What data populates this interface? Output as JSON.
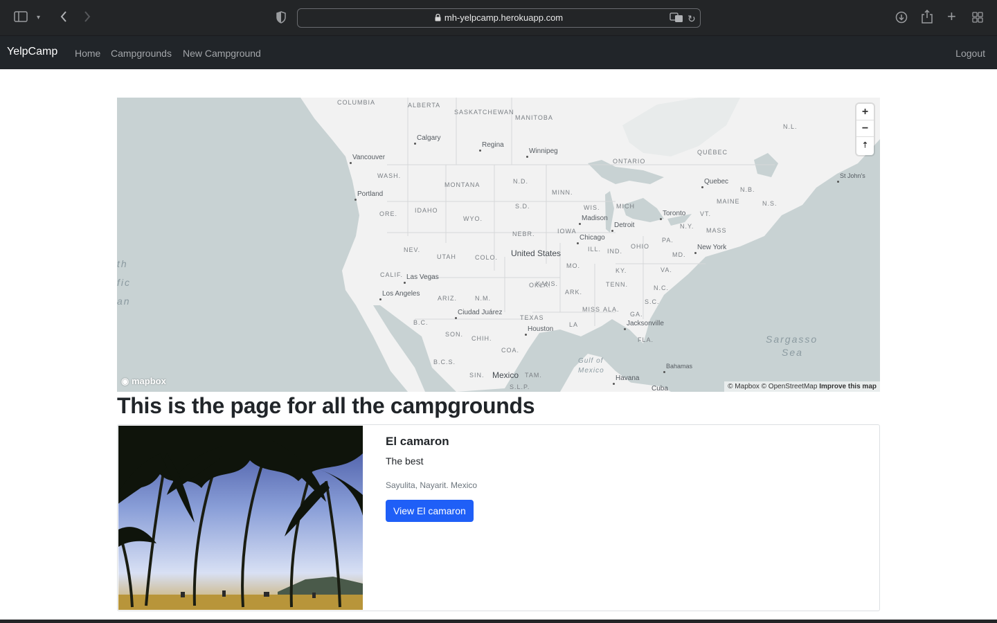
{
  "browser": {
    "url": "mh-yelpcamp.herokuapp.com"
  },
  "navbar": {
    "brand": "YelpCamp",
    "links": [
      "Home",
      "Campgrounds",
      "New Campground"
    ],
    "logout": "Logout"
  },
  "map": {
    "regions": [
      "COLUMBIA",
      "ALBERTA",
      "SASKATCHEWAN",
      "MANITOBA",
      "ONTARIO",
      "QUÉBEC",
      "N.L.",
      "WASH.",
      "MONTANA",
      "N.D.",
      "MINN.",
      "N.B.",
      "MAINE",
      "N.S.",
      "ORE.",
      "IDAHO",
      "S.D.",
      "WIS.",
      "MICH",
      "WYO.",
      "N.Y.",
      "MASS",
      "VT.",
      "NEBR.",
      "IOWA",
      "NEV.",
      "UTAH",
      "COLO.",
      "ILL.",
      "IND.",
      "OHIO",
      "PA.",
      "MO.",
      "KY.",
      "VA.",
      "MD.",
      "CALIF.",
      "KANS.",
      "OKLA.",
      "ARK.",
      "TENN.",
      "N.C.",
      "ARIZ.",
      "N.M.",
      "MISS",
      "ALA.",
      "GA.",
      "S.C.",
      "TEXAS",
      "LA",
      "FLA.",
      "SON.",
      "CHIH.",
      "COA.",
      "B.C.",
      "B.C.S.",
      "S.L.P.",
      "TAM.",
      "SIN."
    ],
    "cities": [
      "Calgary",
      "Regina",
      "Winnipeg",
      "Vancouver",
      "Portland",
      "Quebec",
      "St John's",
      "Toronto",
      "Madison",
      "Detroit",
      "Chicago",
      "New York",
      "Las Vegas",
      "Los Angeles",
      "Ciudad Juárez",
      "Houston",
      "Jacksonville",
      "Havana",
      "Bahamas",
      "Cuba"
    ],
    "countries": [
      "United States",
      "Mexico"
    ],
    "waters": [
      "th",
      "fic",
      "an",
      "Sargasso",
      "Sea",
      "Gulf of",
      "Mexico"
    ],
    "zoom_in": "+",
    "zoom_out": "−",
    "compass": "⇡",
    "logo": "mapbox",
    "attribution": "© Mapbox © OpenStreetMap",
    "improve": "Improve this map"
  },
  "page": {
    "title": "This is the page for all the campgrounds"
  },
  "campgrounds": [
    {
      "title": "El camaron",
      "description": "The best",
      "location": "Sayulita, Nayarit. Mexico",
      "button": "View El camaron"
    }
  ]
}
